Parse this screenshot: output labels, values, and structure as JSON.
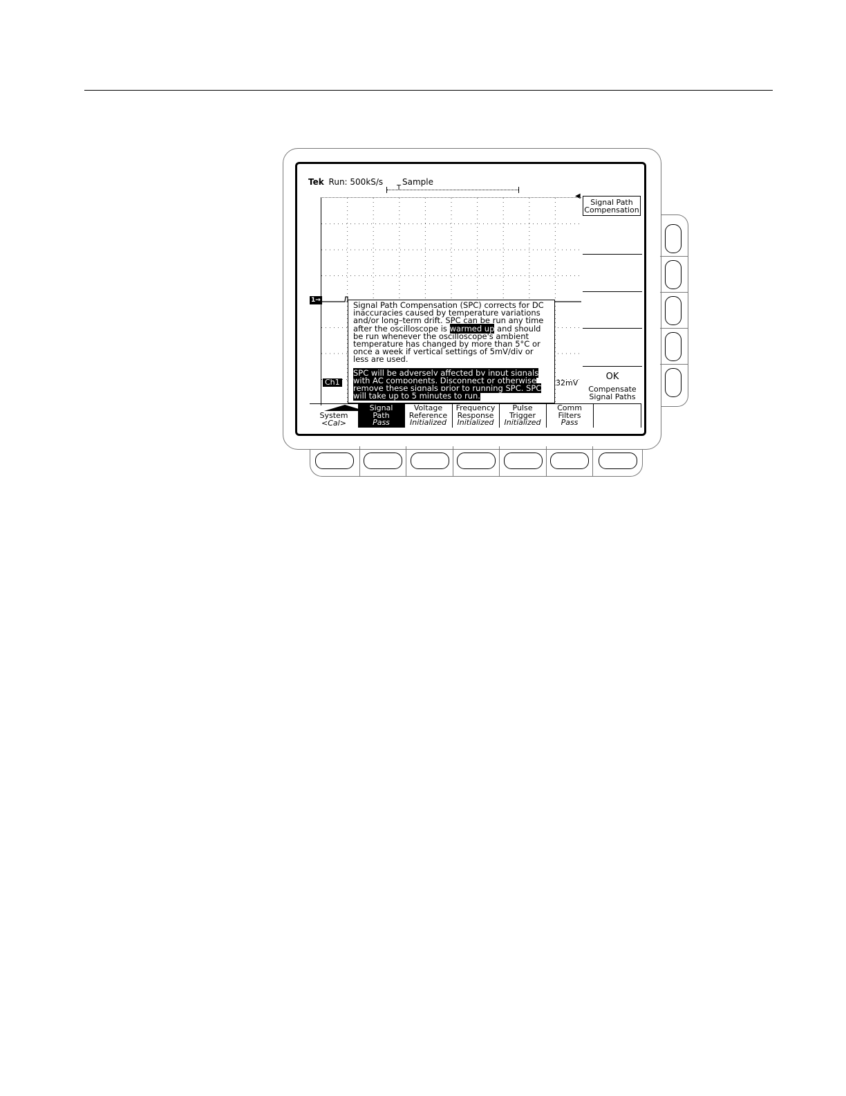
{
  "status": {
    "brand": "Tek",
    "run": "Run: 500kS/s",
    "mode": "Sample",
    "trigger_marker": "T"
  },
  "ground_marker": "1→",
  "message": {
    "paragraph1_before": "Signal Path Compensation (SPC) corrects for DC inaccuracies caused by temperature variations and/or long–term drift. SPC can be run any time after the oscilloscope is ",
    "paragraph1_highlight": "warmed up",
    "paragraph1_after": " and should be run whenever the oscilloscope's ambient temperature has changed by more than 5°C or once a week if vertical settings of 5mV/div or less are used.",
    "paragraph2": "SPC will be adversely affected by input signals with AC components. Disconnect or otherwise remove these signals prior to running SPC. SPC will take up to 5 minutes to run."
  },
  "channel": {
    "label": "Ch1",
    "scale": "32mV"
  },
  "side_menu": {
    "title_line1": "Signal Path",
    "title_line2": "Compensation",
    "ok_label": "OK",
    "ok_sub_line1": "Compensate",
    "ok_sub_line2": "Signal Paths"
  },
  "bottom_menu": {
    "items": [
      {
        "line1": "System",
        "line2": "",
        "state": "<Cal>"
      },
      {
        "line1": "Signal",
        "line2": "Path",
        "state": "Pass"
      },
      {
        "line1": "Voltage",
        "line2": "Reference",
        "state": "Initialized"
      },
      {
        "line1": "Frequency",
        "line2": "Response",
        "state": "Initialized"
      },
      {
        "line1": "Pulse",
        "line2": "Trigger",
        "state": "Initialized"
      },
      {
        "line1": "Comm",
        "line2": "Filters",
        "state": "Pass"
      }
    ]
  }
}
